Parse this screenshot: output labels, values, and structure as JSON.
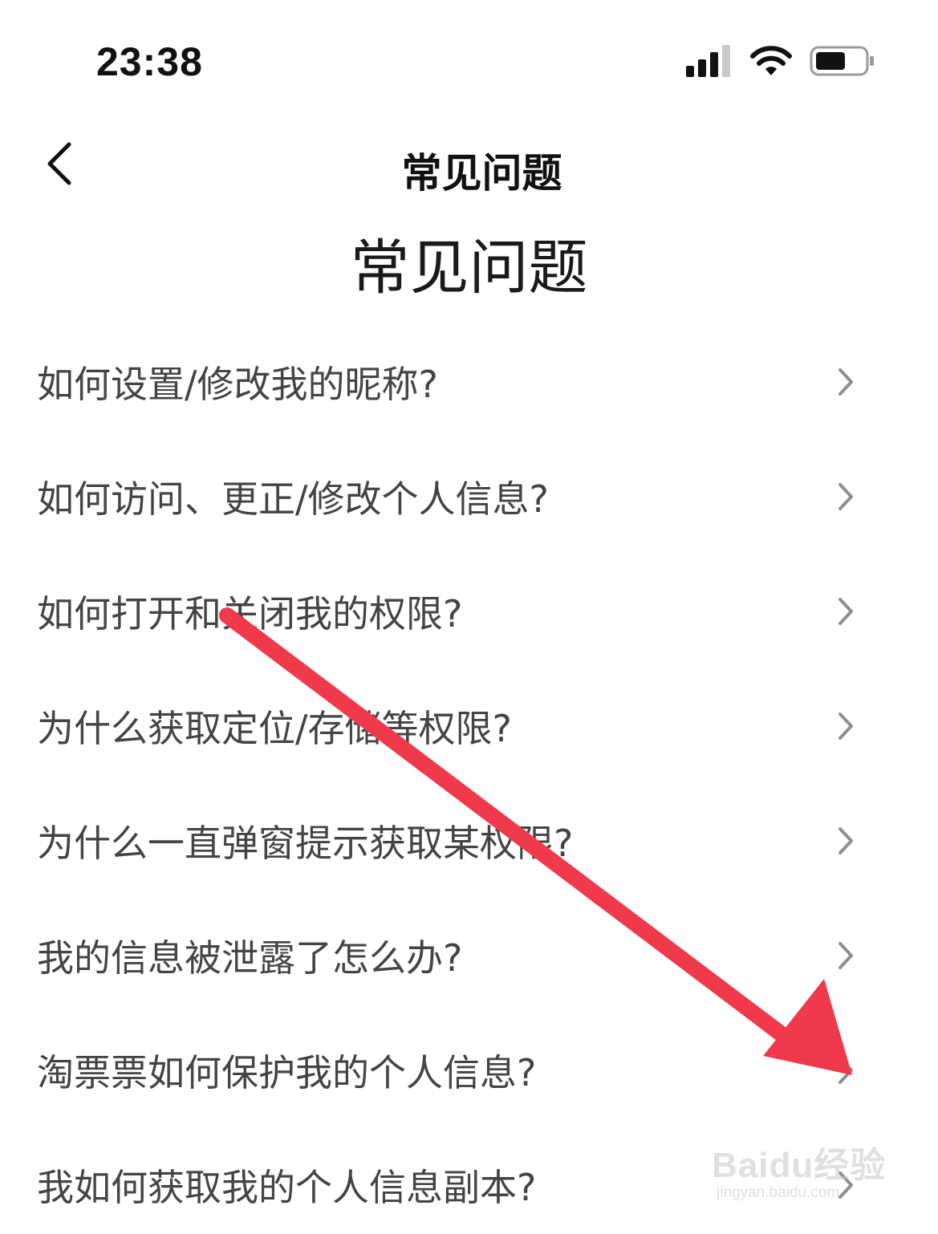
{
  "status_bar": {
    "time": "23:38",
    "signal_icon": "cellular-signal-icon",
    "wifi_icon": "wifi-icon",
    "battery_icon": "battery-icon"
  },
  "nav": {
    "back_icon": "chevron-left-icon",
    "title": "常见问题"
  },
  "page": {
    "heading": "常见问题"
  },
  "faq": {
    "items": [
      {
        "label": "如何设置/修改我的昵称?"
      },
      {
        "label": "如何访问、更正/修改个人信息?"
      },
      {
        "label": "如何打开和关闭我的权限?"
      },
      {
        "label": "为什么获取定位/存储等权限?"
      },
      {
        "label": "为什么一直弹窗提示获取某权限?"
      },
      {
        "label": "我的信息被泄露了怎么办?"
      },
      {
        "label": "淘票票如何保护我的个人信息?"
      },
      {
        "label": "我如何获取我的个人信息副本?"
      }
    ],
    "chevron_icon": "chevron-right-icon"
  },
  "annotation": {
    "arrow_color": "#f0394b"
  },
  "watermark": {
    "brand": "Baidu经验",
    "url": "jingyan.baidu.com"
  }
}
